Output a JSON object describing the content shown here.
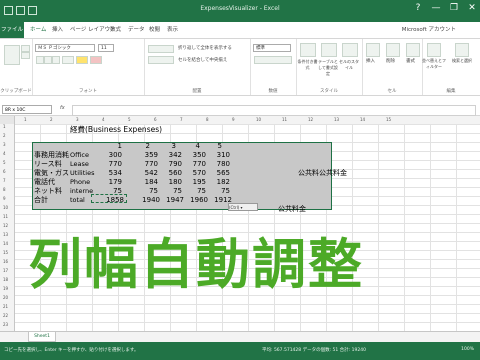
{
  "window": {
    "title": "ExpensesVisualizer - Excel",
    "controls": [
      "?",
      "—",
      "❐",
      "✕"
    ]
  },
  "tabs": [
    {
      "label": "ファイル"
    },
    {
      "label": "ホーム"
    },
    {
      "label": "挿入"
    },
    {
      "label": "ページ レイアウト"
    },
    {
      "label": "数式"
    },
    {
      "label": "データ"
    },
    {
      "label": "校閲"
    },
    {
      "label": "表示"
    }
  ],
  "account": "Microsoft アカウント",
  "ribbon": {
    "font_name": "ＭＳ Ｐゴシック",
    "font_size": "11",
    "wrap_text": "折り返して全体を表示する",
    "merge_center": "セルを結合して中央揃え",
    "number_format": "標準",
    "groups": [
      "クリップボード",
      "フォント",
      "配置",
      "数値",
      "スタイル",
      "セル",
      "編集"
    ],
    "style_btns": [
      "条件付き書式",
      "テーブルとして書式設定",
      "セルのスタイル"
    ],
    "cell_btns": [
      "挿入",
      "削除",
      "書式"
    ],
    "edit_btns": [
      "並べ替えとフィルター",
      "検索と選択"
    ]
  },
  "formula_bar": {
    "name_box": "8R x 10C",
    "fx": "fx"
  },
  "columns": [
    "1",
    "2",
    "3",
    "4",
    "5",
    "6",
    "7",
    "8",
    "9",
    "10",
    "11",
    "12",
    "13",
    "14",
    "15"
  ],
  "rows": [
    "1",
    "2",
    "3",
    "4",
    "5",
    "6",
    "7",
    "8",
    "9",
    "10",
    "11",
    "12",
    "13",
    "14",
    "15",
    "16",
    "17",
    "18",
    "19",
    "20",
    "21",
    "22",
    "23"
  ],
  "sheet": {
    "title": "経費(Business Expenses)",
    "header_nums": [
      "1",
      "2",
      "3",
      "4",
      "5"
    ],
    "table_rows": [
      {
        "jp": "事務用消耗",
        "en": "Office",
        "v": [
          "300",
          "359",
          "342",
          "350",
          "310"
        ]
      },
      {
        "jp": "リース料",
        "en": "Lease",
        "v": [
          "770",
          "770",
          "790",
          "770",
          "780"
        ]
      },
      {
        "jp": "電気・ガス",
        "en": "Utilities",
        "v": [
          "534",
          "542",
          "560",
          "570",
          "565"
        ]
      },
      {
        "jp": "電話代",
        "en": "Phone",
        "v": [
          "179",
          "184",
          "180",
          "195",
          "182"
        ]
      },
      {
        "jp": "ネット料",
        "en": "interne",
        "v": [
          "75",
          "75",
          "75",
          "75",
          "75"
        ]
      },
      {
        "jp": "合計",
        "en": "total",
        "v": [
          "1858",
          "1940",
          "1947",
          "1960",
          "1912"
        ]
      }
    ],
    "side_text_1": "公共料公共料金",
    "side_text_2": "公共料金",
    "paste_tag": "(Ctrl) ▾"
  },
  "caption": "列幅自動調整",
  "sheet_tab": "Sheet1",
  "status": {
    "text": "コピー先を選択し、Enter キーを押すか、貼り付けを選択します。",
    "sum": "平均: 567.571428  データの個数: 51  合計: 19240",
    "zoom": "100%"
  },
  "colors": {
    "accent": "#217346",
    "caption": "#4caa27"
  }
}
